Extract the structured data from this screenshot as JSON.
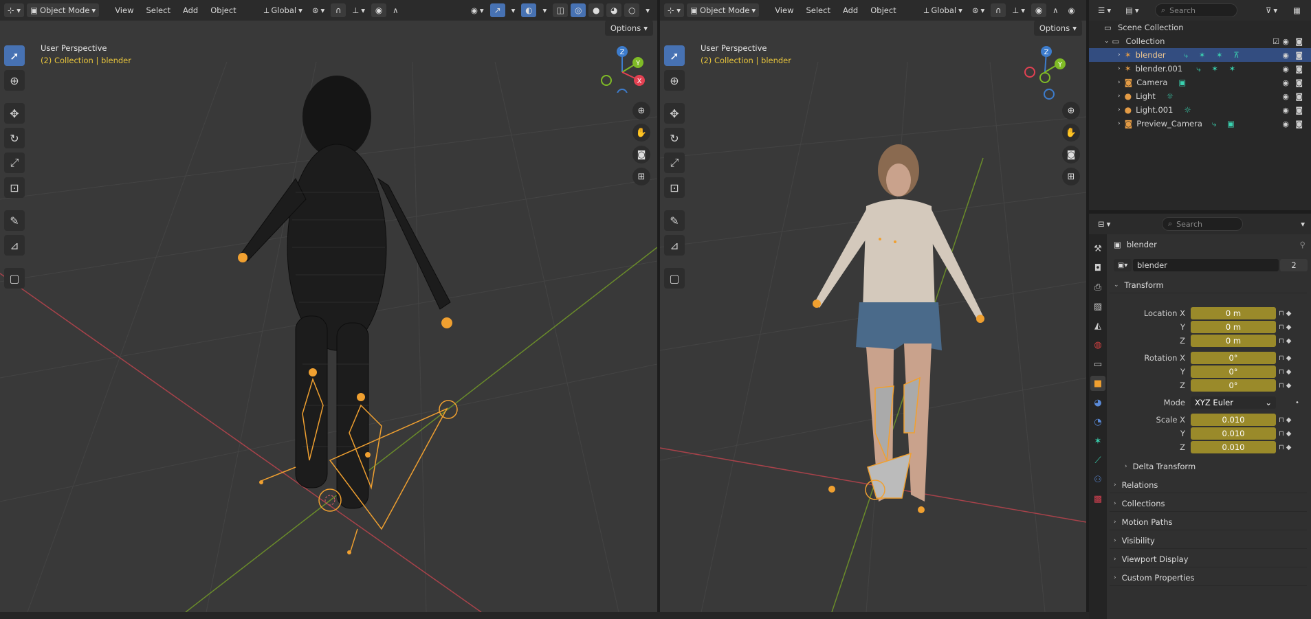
{
  "left_header": {
    "mode": "Object Mode",
    "menus": [
      "View",
      "Select",
      "Add",
      "Object"
    ],
    "orientation": "Global"
  },
  "right_header": {
    "mode": "Object Mode",
    "menus": [
      "View",
      "Select",
      "Add",
      "Object"
    ],
    "orientation": "Global"
  },
  "viewport_left": {
    "title": "User Perspective",
    "subtitle": "(2) Collection | blender",
    "options_label": "Options"
  },
  "viewport_right": {
    "title": "User Perspective",
    "subtitle": "(2) Collection | blender",
    "options_label": "Options"
  },
  "gizmo": {
    "x": "X",
    "y": "Y",
    "z": "Z",
    "x_color": "#e34152",
    "y_color": "#7fbb26",
    "z_color": "#3d7ccc"
  },
  "outliner": {
    "search_placeholder": "Search",
    "scene_collection": "Scene Collection",
    "collection": "Collection",
    "items": [
      {
        "name": "blender",
        "selected": true
      },
      {
        "name": "blender.001",
        "selected": false
      },
      {
        "name": "Camera",
        "selected": false
      },
      {
        "name": "Light",
        "selected": false
      },
      {
        "name": "Light.001",
        "selected": false
      },
      {
        "name": "Preview_Camera",
        "selected": false
      }
    ]
  },
  "properties": {
    "search_placeholder": "Search",
    "object_name": "blender",
    "data_name": "blender",
    "users": "2",
    "transform_label": "Transform",
    "location": {
      "label": "Location X",
      "y": "Y",
      "z": "Z",
      "values": [
        "0 m",
        "0 m",
        "0 m"
      ]
    },
    "rotation": {
      "label": "Rotation X",
      "y": "Y",
      "z": "Z",
      "values": [
        "0°",
        "0°",
        "0°"
      ]
    },
    "mode_label": "Mode",
    "mode_value": "XYZ Euler",
    "scale": {
      "label": "Scale X",
      "y": "Y",
      "z": "Z",
      "values": [
        "0.010",
        "0.010",
        "0.010"
      ]
    },
    "delta_transform": "Delta Transform",
    "panels": [
      "Relations",
      "Collections",
      "Motion Paths",
      "Visibility",
      "Viewport Display",
      "Custom Properties"
    ]
  },
  "colors": {
    "accent": "#4772b3",
    "selection": "#334d80",
    "field_animated": "#9a8a2a",
    "bone": "#f0a030",
    "subtitle": "#e8c53c"
  }
}
